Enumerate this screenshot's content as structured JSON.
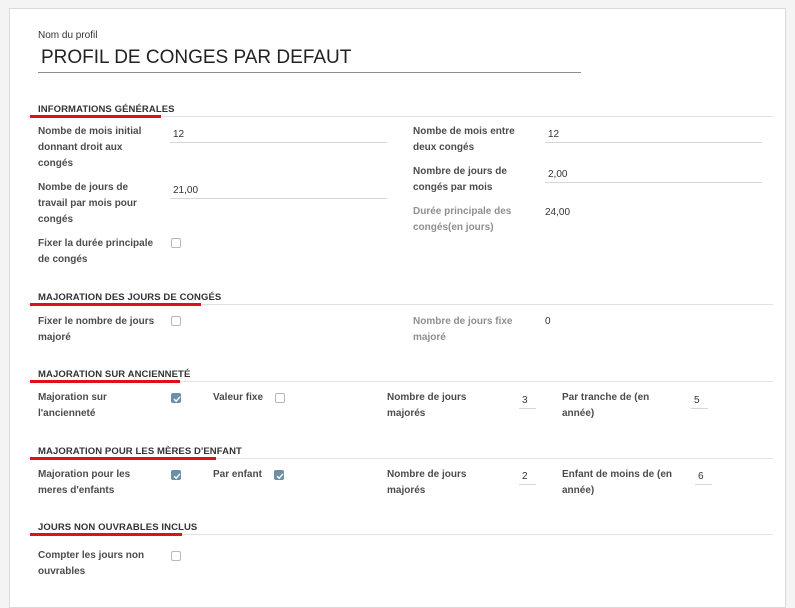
{
  "profile": {
    "name_label": "Nom du profil",
    "name_value": "PROFIL DE CONGES PAR DEFAUT"
  },
  "sections": {
    "general": {
      "title": "INFORMATIONS GÉNÉRALES",
      "initial_months_label": "Nombe de mois initial donnant droit aux congés",
      "initial_months_value": "12",
      "months_between_label": "Nombe de mois entre deux congés",
      "months_between_value": "12",
      "work_days_label": "Nombe de jours de travail par mois pour congés",
      "work_days_value": "21,00",
      "leave_days_label": "Nombre de jours de congés par mois",
      "leave_days_value": "2,00",
      "main_duration_label": "Durée principale des congés(en jours)",
      "main_duration_value": "24,00",
      "fix_duration_label": "Fixer la durée principale de congés",
      "fix_duration_checked": false
    },
    "majoration_days": {
      "title": "MAJORATION DES JOURS DE CONGÉS",
      "fix_count_label": "Fixer le nombre de jours majoré",
      "fix_count_checked": false,
      "fixed_days_label": "Nombre de jours fixe majoré",
      "fixed_days_value": "0"
    },
    "seniority": {
      "title": "MAJORATION SUR ANCIENNETÉ",
      "majoration_label": "Majoration sur l'ancienneté",
      "majoration_checked": true,
      "fixed_value_label": "Valeur fixe",
      "fixed_value_checked": false,
      "days_label": "Nombre de jours majorés",
      "days_value": "3",
      "bracket_label": "Par tranche de (en année)",
      "bracket_value": "5"
    },
    "mothers": {
      "title": "MAJORATION POUR LES MÈRES D'ENFANT",
      "majoration_label": "Majoration pour les meres d'enfants",
      "majoration_checked": true,
      "per_child_label": "Par enfant",
      "per_child_checked": true,
      "days_label": "Nombre de jours majorés",
      "days_value": "2",
      "child_under_label": "Enfant de moins de (en année)",
      "child_under_value": "6"
    },
    "non_working": {
      "title": "JOURS NON OUVRABLES INCLUS",
      "count_label": "Compter les jours non ouvrables",
      "count_checked": false
    }
  }
}
